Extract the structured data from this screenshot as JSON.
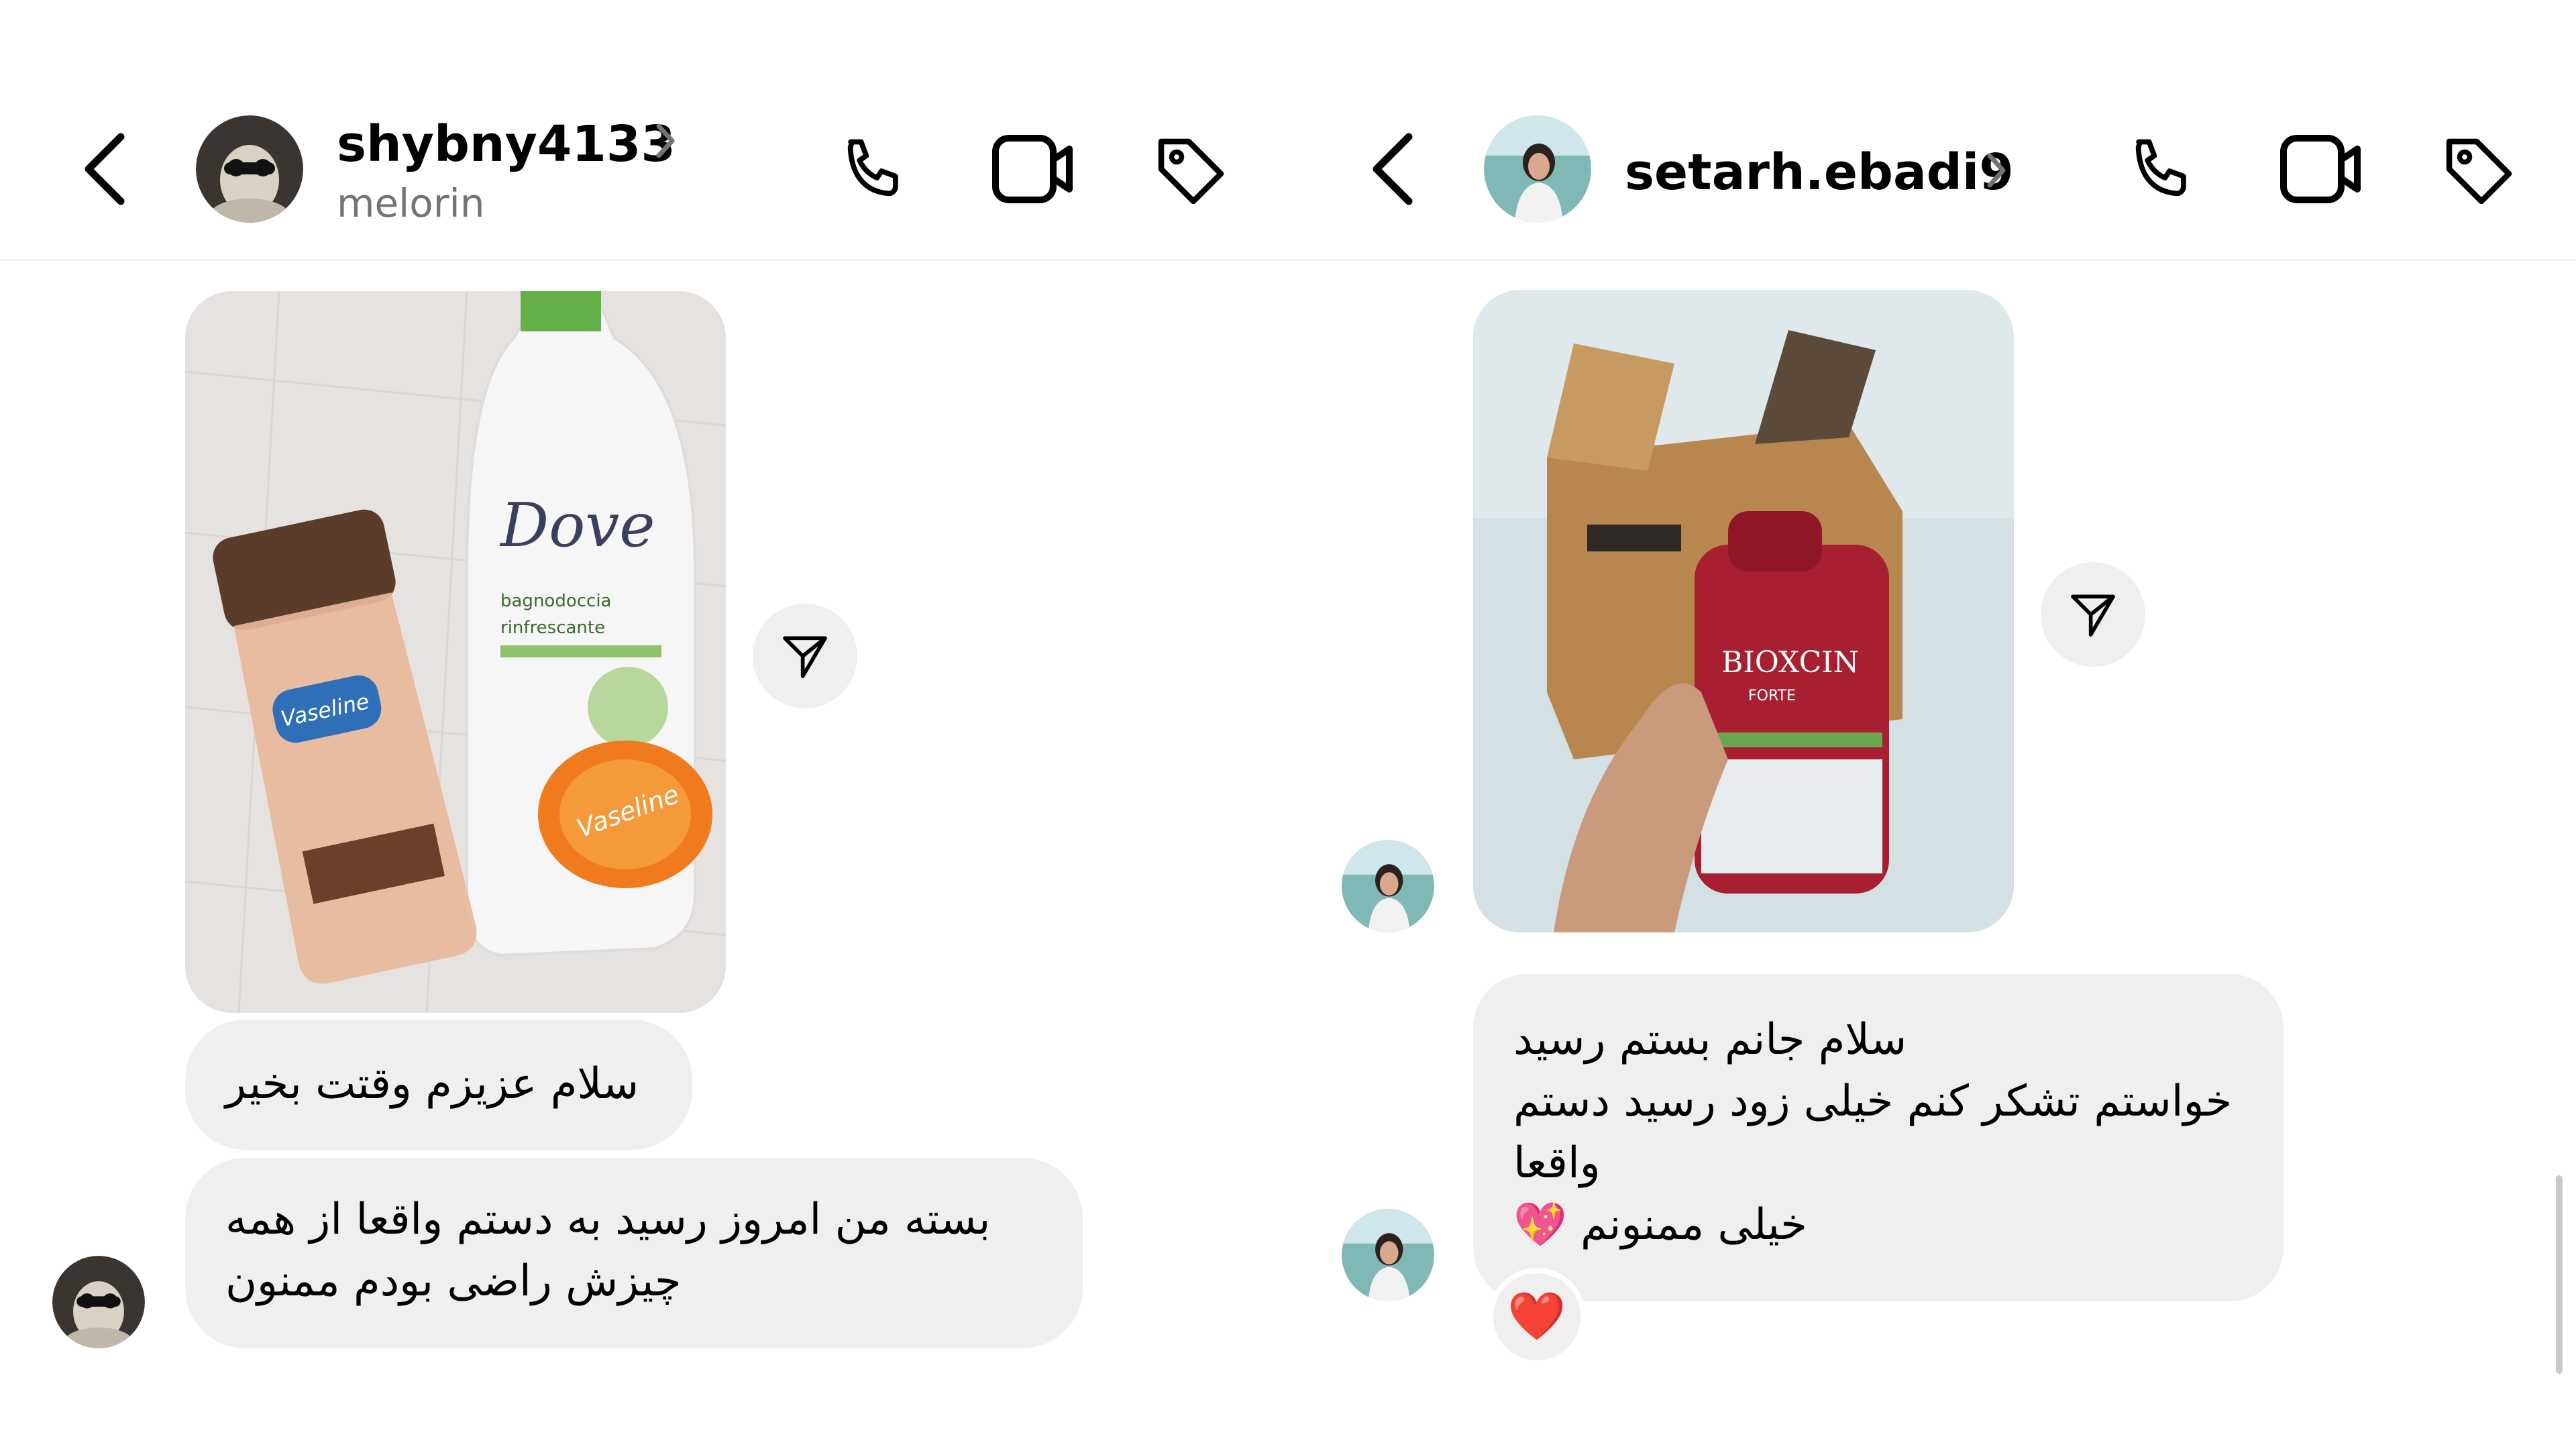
{
  "left_chat": {
    "header": {
      "username": "shybny4133",
      "subtitle": "melorin",
      "back_icon": "chevron-left-icon",
      "profile_chevron_icon": "chevron-right-icon",
      "call_icon": "phone-icon",
      "video_icon": "video-camera-icon",
      "tag_icon": "tag-icon"
    },
    "messages": [
      {
        "type": "photo",
        "description_icon": "product-photo"
      },
      {
        "type": "text",
        "lines": [
          "سلام عزیزم وقتت بخیر"
        ]
      },
      {
        "type": "text",
        "lines": [
          "بسته من امروز رسید به دستم واقعا از همه",
          "چیزش راضی بودم ممنون"
        ]
      }
    ],
    "share_icon": "send-icon"
  },
  "right_chat": {
    "header": {
      "username": "setarh.ebadi9",
      "back_icon": "chevron-left-icon",
      "profile_chevron_icon": "chevron-right-icon",
      "call_icon": "phone-icon",
      "video_icon": "video-camera-icon",
      "tag_icon": "tag-icon"
    },
    "messages": [
      {
        "type": "photo",
        "description_icon": "product-photo"
      },
      {
        "type": "text",
        "lines": [
          "سلام جانم بستم رسید",
          "خواستم تشکر کنم خیلی زود رسید دستم",
          "واقعا",
          "خیلی ممنونم 💖"
        ],
        "reaction": "❤️"
      }
    ],
    "share_icon": "send-icon"
  },
  "colors": {
    "bubble_bg": "#efefef",
    "subtitle_gray": "#737373",
    "reaction_heart": "#e0162b"
  }
}
